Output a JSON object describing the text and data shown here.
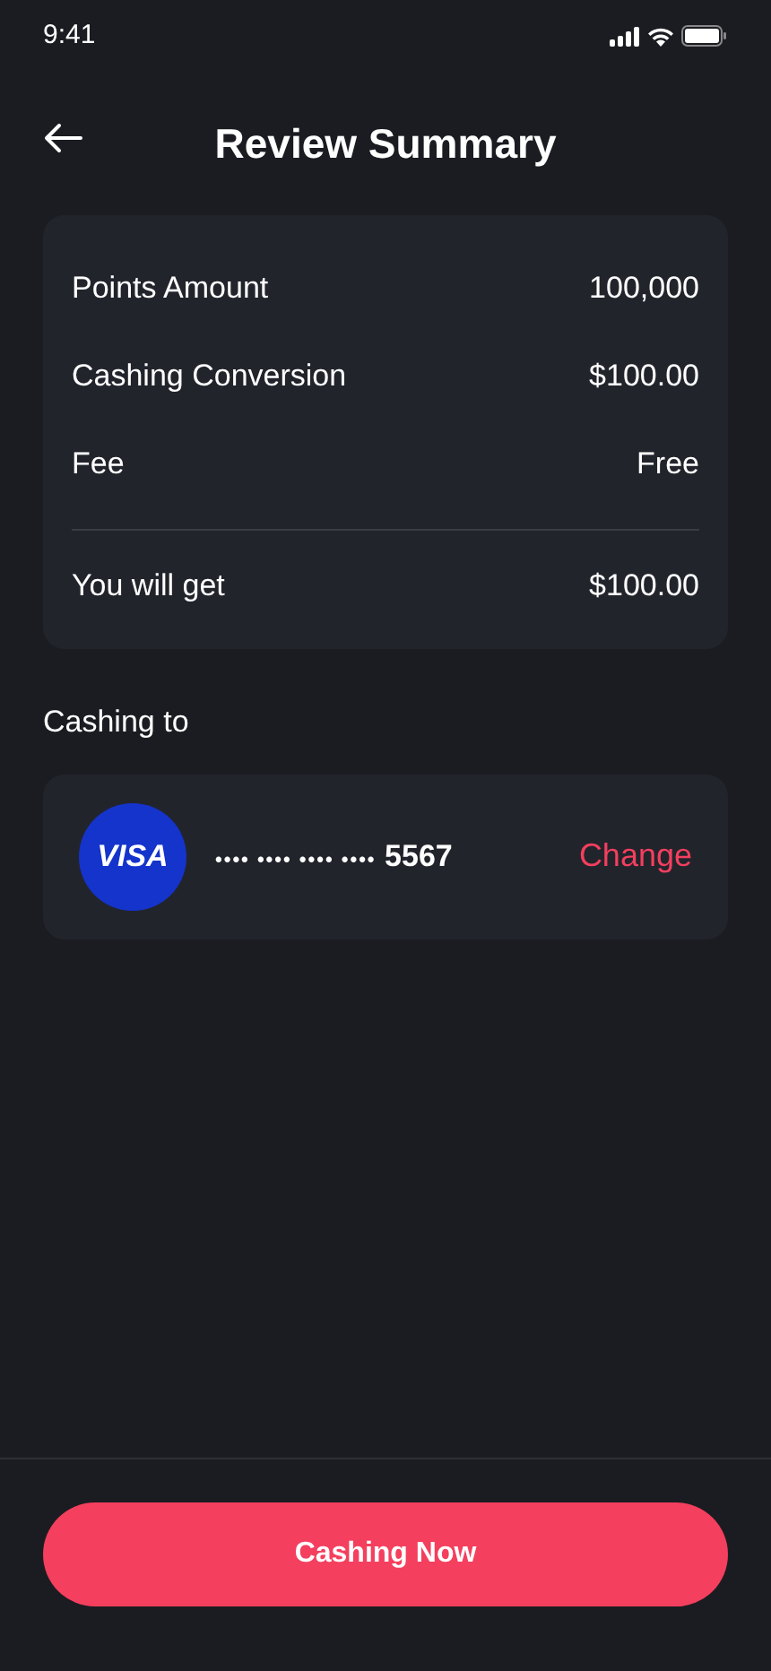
{
  "status_bar": {
    "time": "9:41"
  },
  "header": {
    "title": "Review Summary"
  },
  "summary": {
    "rows": [
      {
        "label": "Points Amount",
        "value": "100,000"
      },
      {
        "label": "Cashing Conversion",
        "value": "$100.00"
      },
      {
        "label": "Fee",
        "value": "Free"
      }
    ],
    "total": {
      "label": "You will get",
      "value": "$100.00"
    }
  },
  "cashing_to": {
    "heading": "Cashing to",
    "card_brand": "VISA",
    "masked": "•••• •••• •••• ••••",
    "last_digits": "5567",
    "change": "Change"
  },
  "primary_button": "Cashing Now"
}
